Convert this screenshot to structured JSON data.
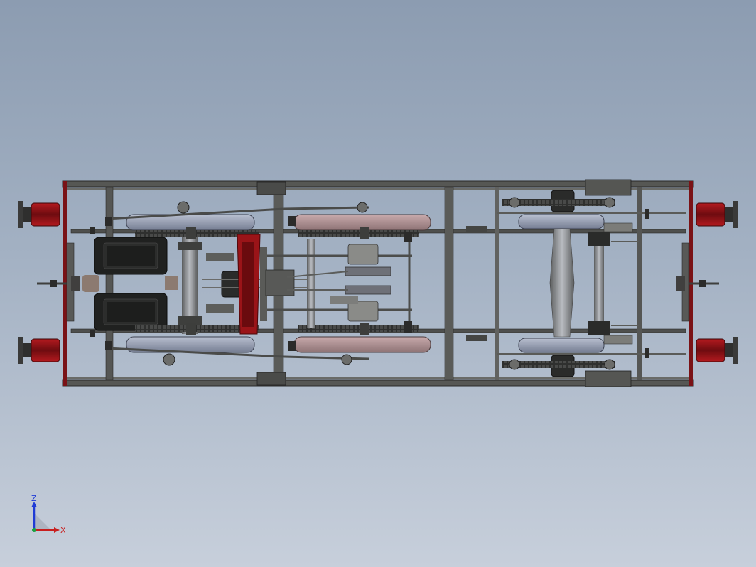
{
  "colors": {
    "bg_top": "#8c9cb1",
    "bg_bottom": "#c7cfdb",
    "frame": "#4b4c4a",
    "frame_dark": "#2c2c2b",
    "buffer_red": "#8a1216",
    "wheel_gray": "#8d95a8",
    "wheel_pink": "#a68a8c",
    "axis_z": "#1f3bd6",
    "axis_x": "#c81e1e",
    "origin": "#1aa040"
  },
  "triad": {
    "z_label": "Z",
    "x_label": "X"
  }
}
